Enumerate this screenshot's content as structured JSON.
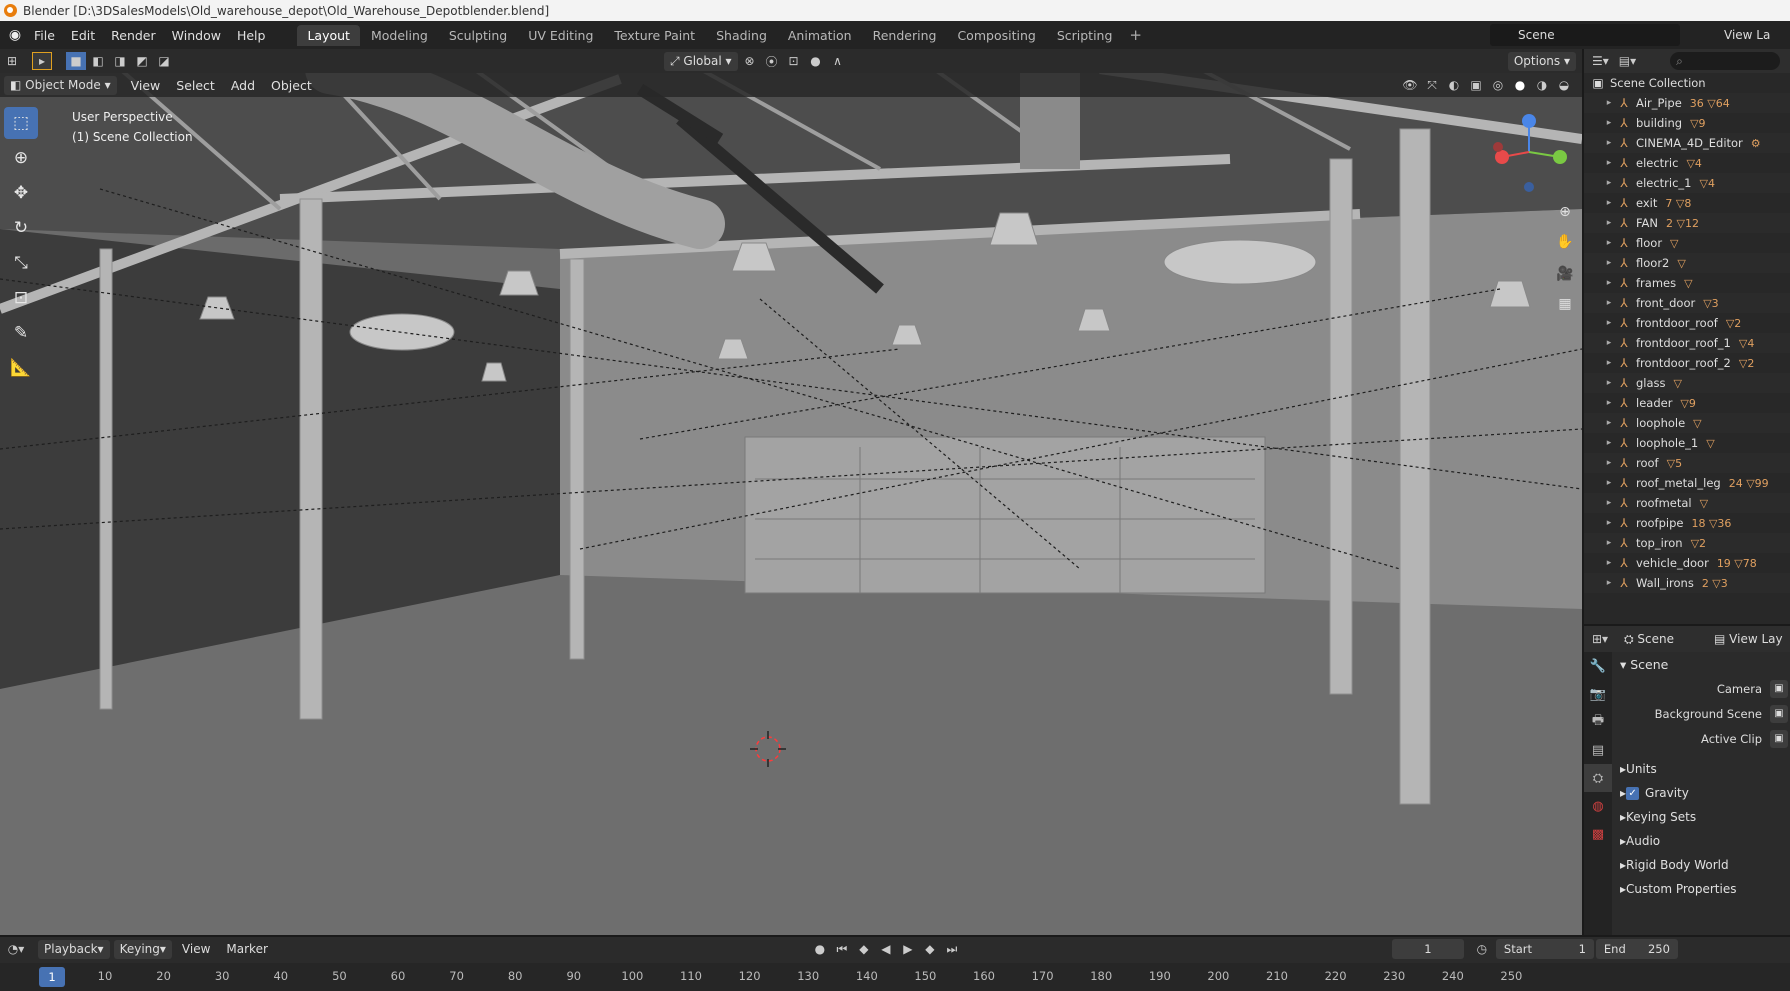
{
  "window": {
    "title": "Blender [D:\\3DSalesModels\\Old_warehouse_depot\\Old_Warehouse_Depotblender.blend]"
  },
  "menu": [
    "File",
    "Edit",
    "Render",
    "Window",
    "Help"
  ],
  "workspaces": [
    "Layout",
    "Modeling",
    "Sculpting",
    "UV Editing",
    "Texture Paint",
    "Shading",
    "Animation",
    "Rendering",
    "Compositing",
    "Scripting"
  ],
  "active_workspace": "Layout",
  "scene_selector": "Scene",
  "view_layer": "View La",
  "viewport": {
    "orientation": "Global",
    "options_label": "Options",
    "mode": "Object Mode",
    "menus": [
      "View",
      "Select",
      "Add",
      "Object"
    ],
    "overlay_line1": "User Perspective",
    "overlay_line2": "(1) Scene Collection"
  },
  "outliner": {
    "root": "Scene Collection",
    "items": [
      {
        "name": "Air_Pipe",
        "badge": "36 ▽64"
      },
      {
        "name": "building",
        "badge": "▽9"
      },
      {
        "name": "CINEMA_4D_Editor",
        "badge": "⚙"
      },
      {
        "name": "electric",
        "badge": "▽4"
      },
      {
        "name": "electric_1",
        "badge": "▽4"
      },
      {
        "name": "exit",
        "badge": "7 ▽8"
      },
      {
        "name": "FAN",
        "badge": "2 ▽12"
      },
      {
        "name": "floor",
        "badge": "▽"
      },
      {
        "name": "floor2",
        "badge": "▽"
      },
      {
        "name": "frames",
        "badge": "▽"
      },
      {
        "name": "front_door",
        "badge": "▽3"
      },
      {
        "name": "frontdoor_roof",
        "badge": "▽2"
      },
      {
        "name": "frontdoor_roof_1",
        "badge": "▽4"
      },
      {
        "name": "frontdoor_roof_2",
        "badge": "▽2"
      },
      {
        "name": "glass",
        "badge": "▽"
      },
      {
        "name": "leader",
        "badge": "▽9"
      },
      {
        "name": "loophole",
        "badge": "▽"
      },
      {
        "name": "loophole_1",
        "badge": "▽"
      },
      {
        "name": "roof",
        "badge": "▽5"
      },
      {
        "name": "roof_metal_leg",
        "badge": "24 ▽99"
      },
      {
        "name": "roofmetal",
        "badge": "▽"
      },
      {
        "name": "roofpipe",
        "badge": "18 ▽36"
      },
      {
        "name": "top_iron",
        "badge": "▽2"
      },
      {
        "name": "vehicle_door",
        "badge": "19 ▽78"
      },
      {
        "name": "Wall_irons",
        "badge": "2 ▽3"
      }
    ]
  },
  "properties": {
    "header_scene": "Scene",
    "header_viewlayer": "View Lay",
    "section": "Scene",
    "rows": [
      "Camera",
      "Background Scene",
      "Active Clip"
    ],
    "collapsed": [
      "Units",
      "Gravity",
      "Keying Sets",
      "Audio",
      "Rigid Body World",
      "Custom Properties"
    ]
  },
  "timeline": {
    "menus": [
      "Playback",
      "Keying",
      "View",
      "Marker"
    ],
    "current_frame": "1",
    "start_label": "Start",
    "start": "1",
    "end_label": "End",
    "end": "250",
    "ruler": [
      "10",
      "20",
      "30",
      "40",
      "50",
      "60",
      "70",
      "80",
      "90",
      "100",
      "110",
      "120",
      "130",
      "140",
      "150",
      "160",
      "170",
      "180",
      "190",
      "200",
      "210",
      "220",
      "230",
      "240",
      "250"
    ]
  }
}
